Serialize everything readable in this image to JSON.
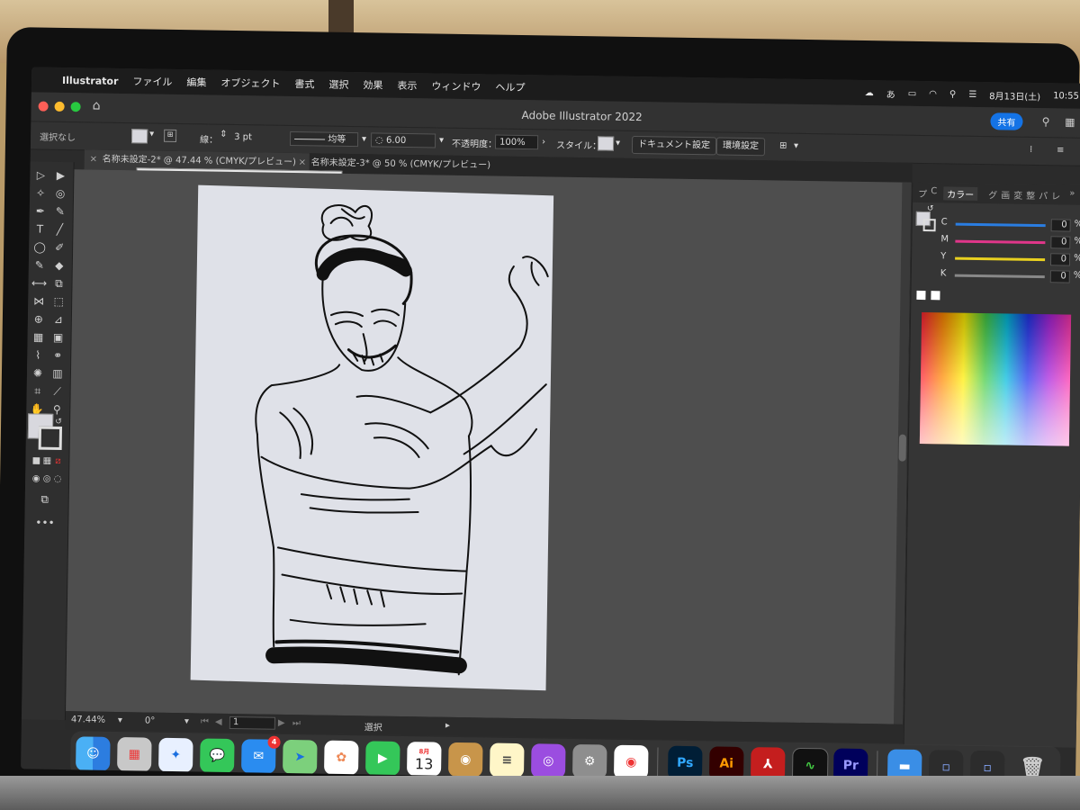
{
  "menubar": {
    "app_name": "Illustrator",
    "items": [
      "ファイル",
      "編集",
      "オブジェクト",
      "書式",
      "選択",
      "効果",
      "表示",
      "ウィンドウ",
      "ヘルプ"
    ],
    "date": "8月13日(土)",
    "time": "10:55"
  },
  "window": {
    "title": "Adobe Illustrator 2022",
    "share_label": "共有"
  },
  "controlbar": {
    "selection_status": "選択なし",
    "stroke_label": "線：",
    "stroke_weight": "3 pt",
    "profile": "均等",
    "brush_size": "6.00",
    "opacity_label": "不透明度：",
    "opacity_value": "100%",
    "style_label": "スタイル：",
    "doc_setup_button": "ドキュメント設定",
    "prefs_button": "環境設定"
  },
  "tabs": [
    {
      "label": "名称未設定-2* @ 47.44 % (CMYK/プレビュー)",
      "active": true
    },
    {
      "label": "名称未設定-3* @ 50 % (CMYK/プレビュー)",
      "active": false
    }
  ],
  "tooltip": "名称未設定-2* @ 47.44 % (CMYK/プレビュー)",
  "statusbar": {
    "zoom": "47.44%",
    "rotation": "0°",
    "artboard": "1",
    "tool": "選択"
  },
  "color_panel": {
    "tabs": [
      "プ",
      "C",
      "カラー",
      "グ",
      "画",
      "変",
      "整",
      "パ",
      "レ"
    ],
    "active_tab": "カラー",
    "channels": [
      {
        "label": "C",
        "value": "0",
        "color": "#2a7de1"
      },
      {
        "label": "M",
        "value": "0",
        "color": "#e0368a"
      },
      {
        "label": "Y",
        "value": "0",
        "color": "#e8d020"
      },
      {
        "label": "K",
        "value": "0",
        "color": "#888888"
      }
    ],
    "percent_sign": "%"
  },
  "dock": {
    "mail_badge": "4",
    "calendar_month": "8月",
    "calendar_day": "13",
    "apps": [
      "Finder",
      "Launchpad",
      "Safari",
      "Messages",
      "Mail",
      "Maps",
      "Photos",
      "FaceTime",
      "Calendar",
      "Contacts",
      "Notes",
      "Podcasts",
      "System Preferences",
      "Chrome",
      "Ps",
      "Ai",
      "Acrobat",
      "Activity Monitor",
      "Pr",
      "Folder",
      "Window",
      "Window",
      "Trash"
    ]
  },
  "colors": {
    "accent": "#1473e6",
    "ps": "#31a8ff",
    "ai": "#ff9a00",
    "pr": "#9999ff"
  }
}
